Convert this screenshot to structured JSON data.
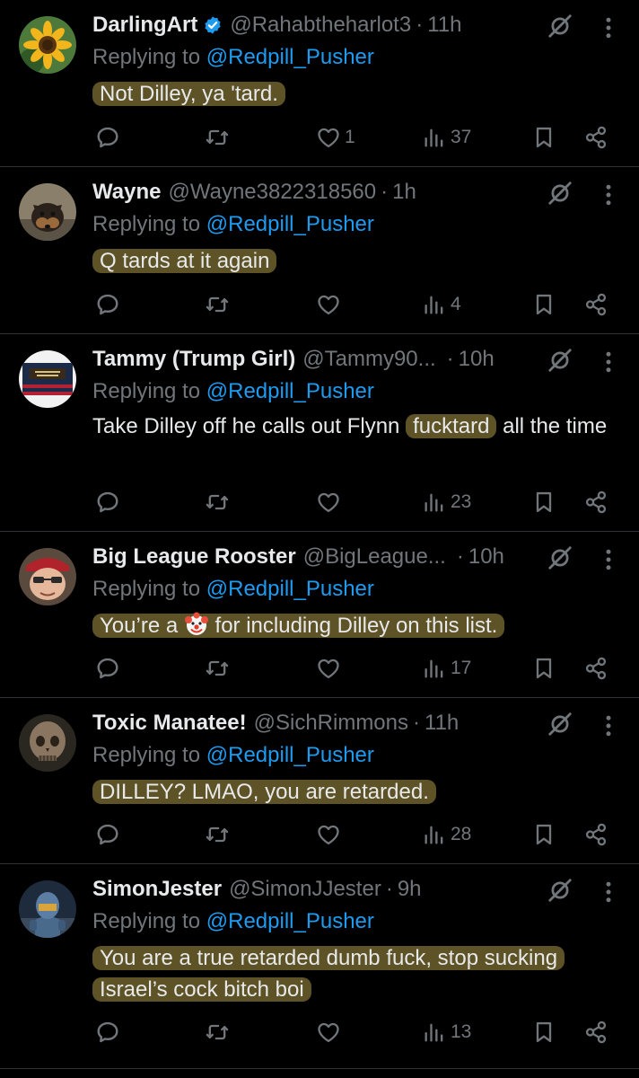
{
  "replying_label": "Replying to",
  "tweets": [
    {
      "name": "DarlingArt",
      "verified": true,
      "handle": "@Rahabtheharlot3",
      "time": "11h",
      "replying_to": "@Redpill_Pusher",
      "text": "Not Dilley, ya 'tard.",
      "likes": "1",
      "views": "37"
    },
    {
      "name": "Wayne",
      "handle": "@Wayne3822318560",
      "time": "1h",
      "replying_to": "@Redpill_Pusher",
      "text": "Q tards at it again",
      "views": "4"
    },
    {
      "name": "Tammy (Trump Girl)",
      "handle": "@Tammy90...",
      "time": "10h",
      "replying_to": "@Redpill_Pusher",
      "text_before": "Take Dilley off he calls out Flynn",
      "text_highlight": "fucktard",
      "text_after": "all the time",
      "views": "23"
    },
    {
      "name": "Big League Rooster",
      "handle": "@BigLeague...",
      "time": "10h",
      "replying_to": "@Redpill_Pusher",
      "text_before": "You’re a",
      "emoji": "clown-face-emoji",
      "text_after": "for including Dilley on this list.",
      "views": "17"
    },
    {
      "name": "Toxic Manatee!",
      "handle": "@SichRimmons",
      "time": "11h",
      "replying_to": "@Redpill_Pusher",
      "text": "DILLEY? LMAO, you are retarded.",
      "views": "28"
    },
    {
      "name": "SimonJester",
      "handle": "@SimonJJester",
      "time": "9h",
      "replying_to": "@Redpill_Pusher",
      "text": "You are a true retarded dumb fuck, stop sucking Israel’s cock bitch boi",
      "views": "13"
    }
  ],
  "icons": {
    "reply": "reply-icon",
    "repost": "repost-icon",
    "like": "heart-icon",
    "views": "views-icon",
    "bookmark": "bookmark-icon",
    "share": "share-icon",
    "mute": "grok-icon",
    "more": "more-vertical-icon",
    "verified": "verified-badge-icon"
  },
  "colors": {
    "background": "#000000",
    "text": "#e7e9ea",
    "muted": "#71767b",
    "link": "#1d9bf0",
    "highlight": "#5e5326",
    "verified": "#1d9bf0"
  }
}
